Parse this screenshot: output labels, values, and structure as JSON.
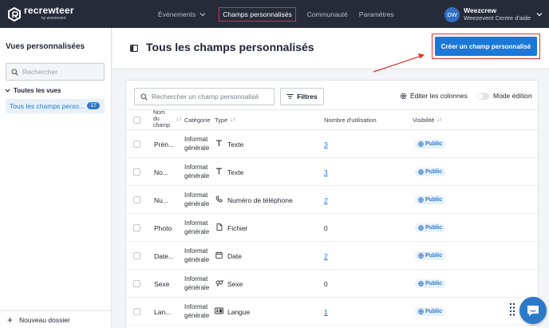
{
  "brand": {
    "name": "recrewteer",
    "sub": "by weezevent"
  },
  "nav": {
    "items": [
      {
        "label": "Événements",
        "has_dropdown": true
      },
      {
        "label": "Champs personnalisés",
        "active": true
      },
      {
        "label": "Communauté"
      },
      {
        "label": "Paramètres"
      }
    ]
  },
  "user": {
    "initials": "DW",
    "name": "Weezcrew",
    "org": "Weezevent Centre d'aide"
  },
  "sidebar": {
    "title": "Vues personnalisées",
    "search_placeholder": "Rechercher",
    "group_label": "Toutes les vues",
    "active_item": {
      "label": "Tous les champs perso...",
      "count": "17"
    },
    "footer_label": "Nouveau dossier"
  },
  "header": {
    "title": "Tous les champs personnalisés",
    "create_button": "Créer un champ personnalisé"
  },
  "toolbar": {
    "search_placeholder": "Rechercher un champ personnalisé",
    "filters": "Filtres",
    "edit_columns": "Éditer les colonnes",
    "edit_mode": "Mode édition"
  },
  "table": {
    "headers": {
      "name_line1": "Nom",
      "name_line2": "du",
      "name_line3": "champ",
      "category": "Catégorie",
      "type": "Type",
      "usage": "Nombre d'utilisation",
      "visibility": "Visibilité",
      "sort_glyph": "↓↑"
    },
    "rows": [
      {
        "name": "Prén...",
        "category_l1": "Informat",
        "category_l2": "générale",
        "type_icon": "text-icon",
        "type": "Texte",
        "usage": "3",
        "usage_link": true,
        "visibility": "Public"
      },
      {
        "name": "No...",
        "category_l1": "Informat",
        "category_l2": "générale",
        "type_icon": "text-icon",
        "type": "Texte",
        "usage": "3",
        "usage_link": true,
        "visibility": "Public"
      },
      {
        "name": "Nu...",
        "category_l1": "Informat",
        "category_l2": "générale",
        "type_icon": "phone-icon",
        "type": "Numéro de téléphone",
        "usage": "2",
        "usage_link": true,
        "visibility": "Public"
      },
      {
        "name": "Photo",
        "category_l1": "Informat",
        "category_l2": "générale",
        "type_icon": "file-icon",
        "type": "Fichier",
        "usage": "0",
        "usage_link": false,
        "visibility": "Public"
      },
      {
        "name": "Date...",
        "category_l1": "Informat",
        "category_l2": "générale",
        "type_icon": "calendar-icon",
        "type": "Date",
        "usage": "2",
        "usage_link": true,
        "visibility": "Public"
      },
      {
        "name": "Sexe",
        "category_l1": "Informat",
        "category_l2": "générale",
        "type_icon": "gender-icon",
        "type": "Sexe",
        "usage": "0",
        "usage_link": false,
        "visibility": "Public"
      },
      {
        "name": "Lan...",
        "category_l1": "Informat",
        "category_l2": "générale",
        "type_icon": "language-icon",
        "type": "Langue",
        "usage": "1",
        "usage_link": true,
        "visibility": "Public"
      }
    ]
  },
  "colors": {
    "topbar": "#262b3a",
    "accent": "#1a78d9",
    "highlight": "#e0332f",
    "badge_bg": "#e8f1fb"
  }
}
